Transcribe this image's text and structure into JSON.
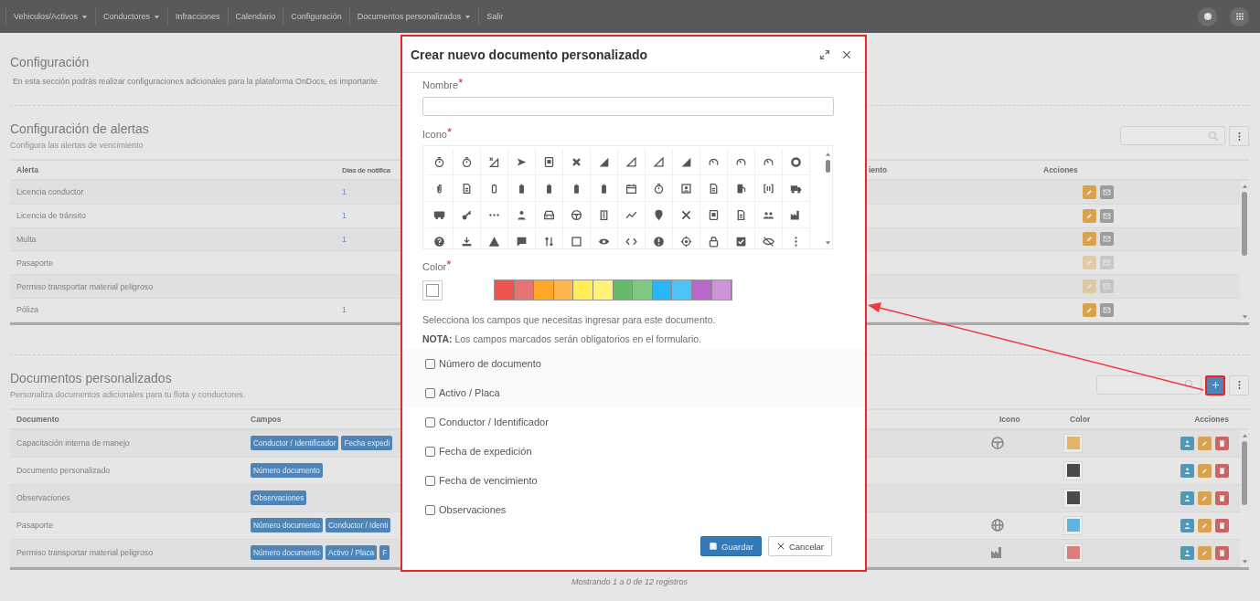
{
  "nav": {
    "items": [
      {
        "label": "Vehiculos/Activos",
        "dropdown": true
      },
      {
        "label": "Conductores",
        "dropdown": true
      },
      {
        "label": "Infracciones",
        "dropdown": false
      },
      {
        "label": "Calendario",
        "dropdown": false
      },
      {
        "label": "Configuración",
        "dropdown": false
      },
      {
        "label": "Documentos personalizados",
        "dropdown": true
      },
      {
        "label": "Salir",
        "dropdown": false
      }
    ]
  },
  "config": {
    "title": "Configuración",
    "description": "En esta sección podrás realizar configuraciones adicionales para la plataforma OnDocs, es importante"
  },
  "alerts": {
    "title": "Configuración de alertas",
    "subtitle": "Configura las alertas de vencimiento",
    "columns": [
      "Alerta",
      "Días de notifica",
      "iento",
      "Acciones"
    ],
    "rows": [
      {
        "alert": "Licencia conductor",
        "days": "1",
        "actions_enabled": true
      },
      {
        "alert": "Licencia de tránsito",
        "days": "1",
        "actions_enabled": true
      },
      {
        "alert": "Multa",
        "days": "1",
        "actions_enabled": true
      },
      {
        "alert": "Pasaporte",
        "actions_enabled": false
      },
      {
        "alert": "Permiso transportar material peligroso",
        "actions_enabled": false
      },
      {
        "alert": "Póliza",
        "days": "1",
        "actions_enabled": true
      }
    ]
  },
  "documents": {
    "title": "Documentos personalizados",
    "subtitle": "Personaliza documentos adicionales para tu flota y conductores.",
    "columns": [
      "Documento",
      "Campos",
      "Icono",
      "Color",
      "Acciones"
    ],
    "rows": [
      {
        "name": "Capacitación interna de manejo",
        "fields": [
          "Conductor / Identificador",
          "Fecha expedi"
        ],
        "color": "#e2b46a"
      },
      {
        "name": "Documento personalizado",
        "fields": [
          "Número documento"
        ],
        "color": "#4a4a4a"
      },
      {
        "name": "Observaciones",
        "fields": [
          "Observaciones"
        ],
        "color": "#4a4a4a"
      },
      {
        "name": "Pasaporte",
        "fields": [
          "Número documento",
          "Conductor / Identi"
        ],
        "color": "#62b2dc"
      },
      {
        "name": "Permiso transportar material peligroso",
        "fields": [
          "Número documento",
          "Activo / Placa",
          "F"
        ],
        "color": "#dc7c7c"
      }
    ]
  },
  "footer": "Mostrando 1 a 0 de 12 registros",
  "modal": {
    "title": "Crear nuevo documento personalizado",
    "name_label": {
      "text": "Nombre",
      "mark": "*"
    },
    "icon_label": {
      "text": "Icono",
      "mark": "*"
    },
    "color_label": {
      "text": "Color",
      "mark": "*"
    },
    "palette": [
      {
        "color": "#ef5350"
      },
      {
        "color": "#e57373"
      },
      {
        "color": "#ffa726"
      },
      {
        "color": "#ffb74d"
      },
      {
        "color": "#ffee58"
      },
      {
        "color": "#fff176"
      },
      {
        "color": "#66bb6a"
      },
      {
        "color": "#81c784"
      },
      {
        "color": "#29b6f6"
      },
      {
        "color": "#4fc3f7"
      },
      {
        "color": "#ba68c8"
      },
      {
        "color": "#ce93d8"
      }
    ],
    "instructions": "Selecciona los campos que necesitas ingresar para este documento.",
    "note": "**NOTA:** Los campos marcados serán obligatorios en el formulario.",
    "fields": [
      {
        "label": "Número de documento",
        "checked": false
      },
      {
        "label": "Activo / Placa",
        "checked": false
      },
      {
        "label": "Conductor / Identificador",
        "checked": false
      },
      {
        "label": "Fecha de expedición",
        "checked": false
      },
      {
        "label": "Fecha de vencimiento",
        "checked": false
      },
      {
        "label": "Observaciones",
        "checked": false
      }
    ],
    "buttons": [
      {
        "label": "Guardar",
        "kind": "primary"
      },
      {
        "label": "Cancelar",
        "kind": "default"
      }
    ]
  }
}
